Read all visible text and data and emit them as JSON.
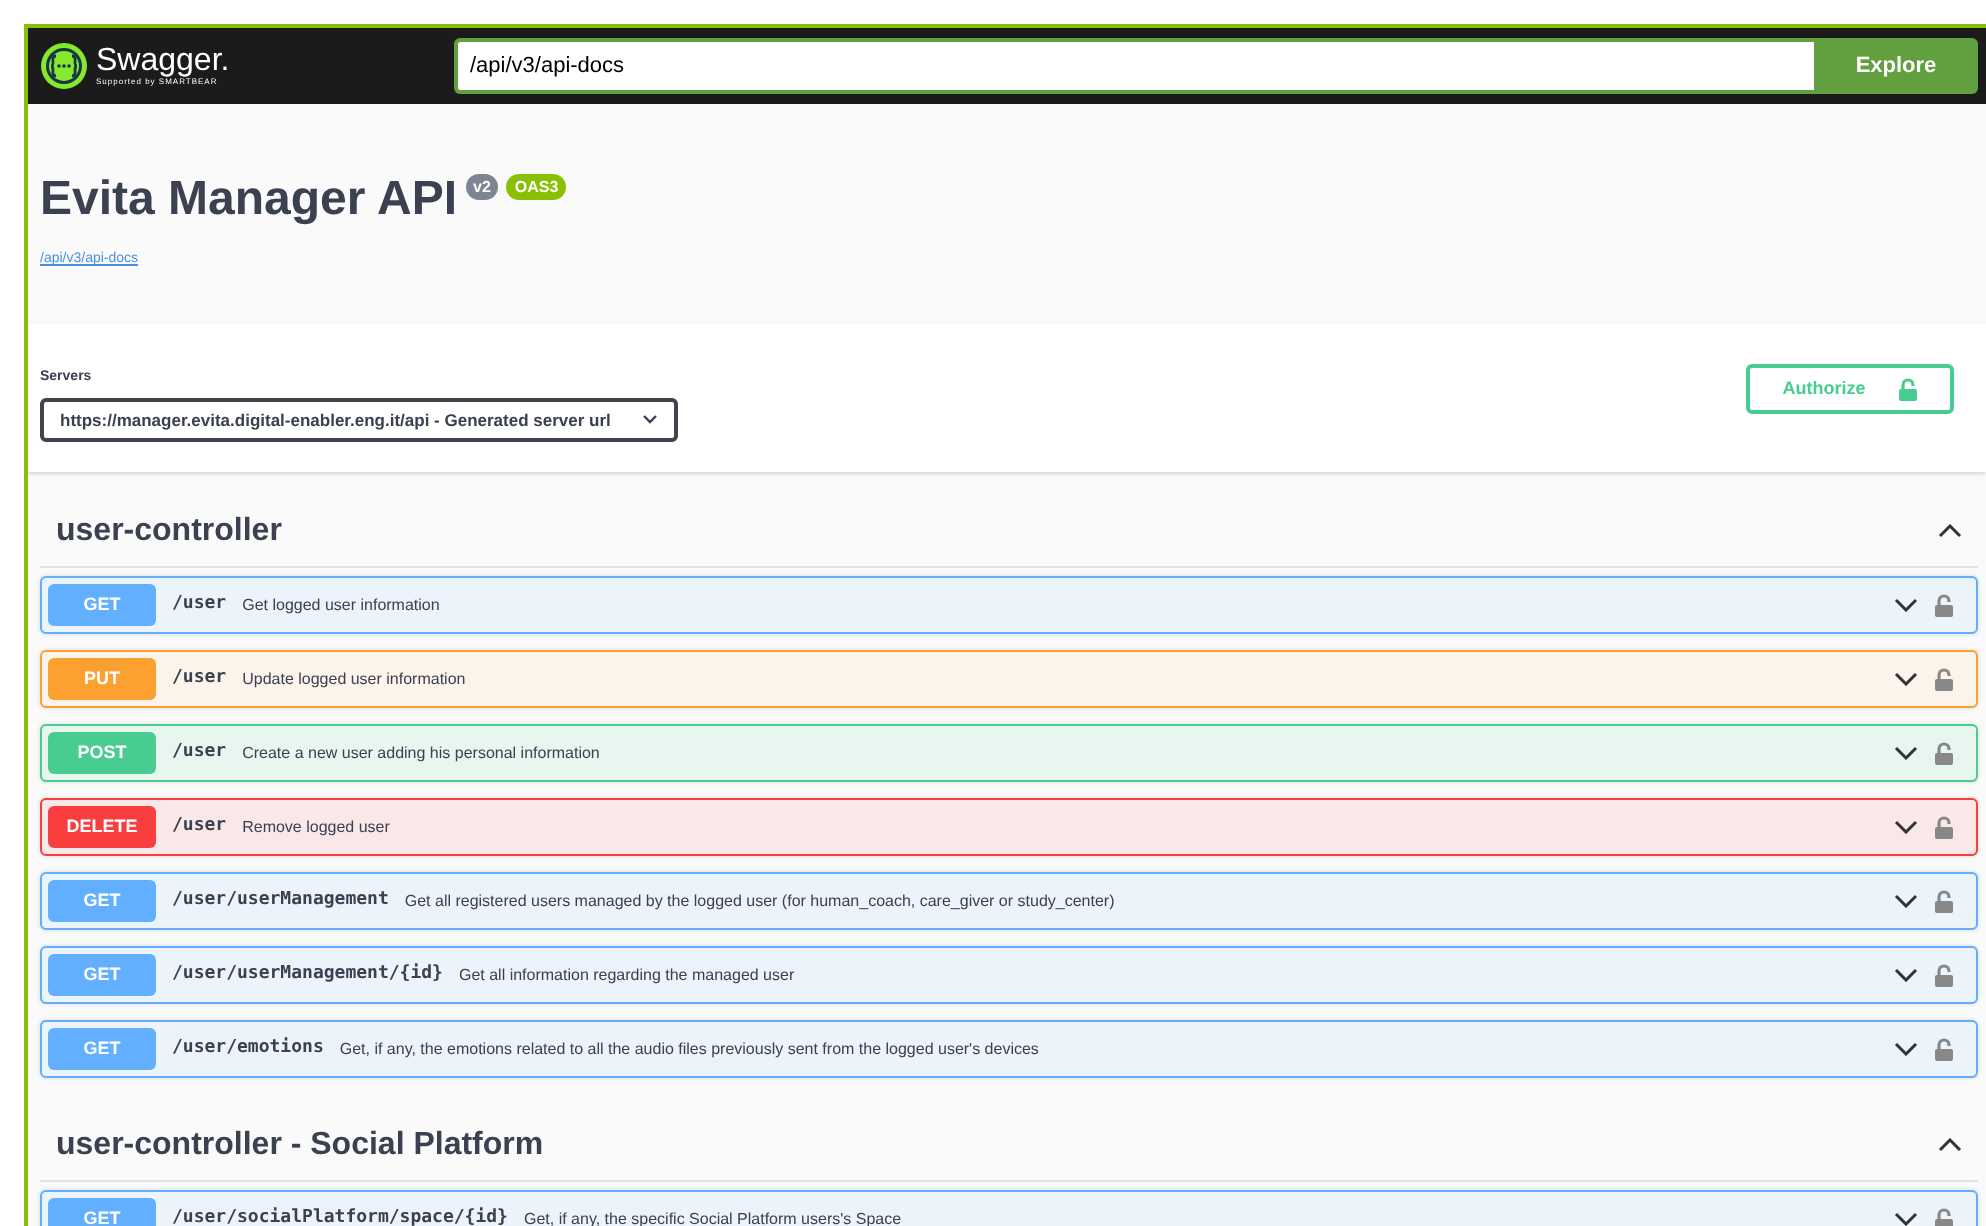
{
  "topbar": {
    "brand": "Swagger",
    "brand_mark": ".",
    "tagline": "Supported by SMARTBEAR",
    "url": "/api/v3/api-docs",
    "explore": "Explore"
  },
  "info": {
    "title": "Evita Manager API",
    "version": "v2",
    "oas": "OAS3",
    "link": "/api/v3/api-docs"
  },
  "servers": {
    "label": "Servers",
    "value": "https://manager.evita.digital-enabler.eng.it/api - Generated server url",
    "authorize": "Authorize"
  },
  "sections": [
    {
      "name": "user-controller",
      "expanded": true,
      "operations": [
        {
          "method": "GET",
          "path": "/user",
          "summary": "Get logged user information",
          "expanded": false
        },
        {
          "method": "PUT",
          "path": "/user",
          "summary": "Update logged user information",
          "expanded": false
        },
        {
          "method": "POST",
          "path": "/user",
          "summary": "Create a new user adding his personal information",
          "expanded": false
        },
        {
          "method": "DELETE",
          "path": "/user",
          "summary": "Remove logged user",
          "expanded": false
        },
        {
          "method": "GET",
          "path": "/user/userManagement",
          "summary": "Get all registered users managed by the logged user (for human_coach, care_giver or study_center)",
          "expanded": false
        },
        {
          "method": "GET",
          "path": "/user/userManagement/{id}",
          "summary": "Get all information regarding the managed user",
          "expanded": false
        },
        {
          "method": "GET",
          "path": "/user/emotions",
          "summary": "Get, if any, the emotions related to all the audio files previously sent from the logged user's devices",
          "expanded": false
        }
      ]
    },
    {
      "name": "user-controller - Social Platform",
      "expanded": true,
      "operations": [
        {
          "method": "GET",
          "path": "/user/socialPlatform/space/{id}",
          "summary": "Get, if any, the specific Social Platform users's Space",
          "expanded": false
        }
      ]
    }
  ]
}
